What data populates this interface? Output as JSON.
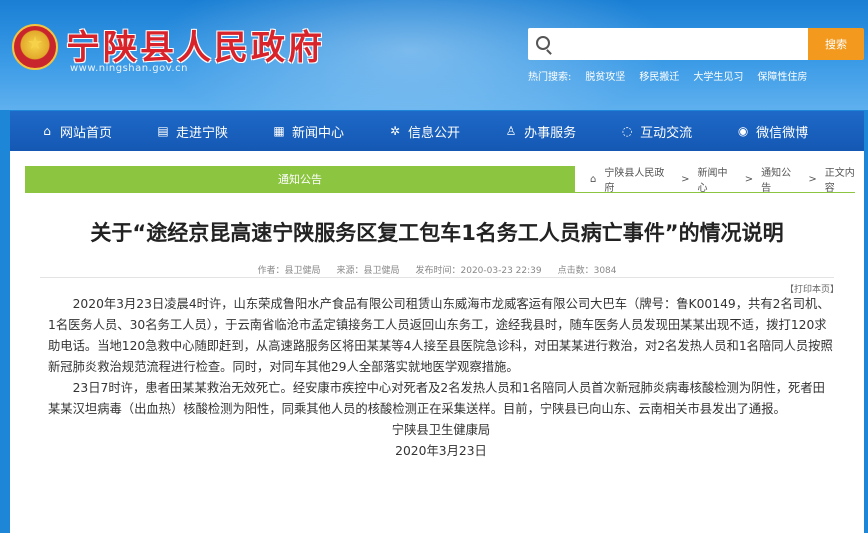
{
  "site": {
    "title": "宁陕县人民政府",
    "url": "www.ningshan.gov.cn"
  },
  "search": {
    "placeholder": "",
    "button_label": "搜索",
    "hot_label": "热门搜索:",
    "hot_items": [
      "脱贫攻坚",
      "移民搬迁",
      "大学生见习",
      "保障性住房"
    ]
  },
  "nav": {
    "items": [
      {
        "label": "网站首页",
        "icon": "home-icon"
      },
      {
        "label": "走进宁陕",
        "icon": "document-icon"
      },
      {
        "label": "新闻中心",
        "icon": "news-icon"
      },
      {
        "label": "信息公开",
        "icon": "gear-icon"
      },
      {
        "label": "办事服务",
        "icon": "user-icon"
      },
      {
        "label": "互动交流",
        "icon": "chat-icon"
      },
      {
        "label": "微信微博",
        "icon": "weibo-icon"
      }
    ]
  },
  "section": {
    "tab_label": "通知公告",
    "breadcrumb": [
      "宁陕县人民政府",
      ">",
      "新闻中心",
      ">",
      "通知公告",
      ">",
      "正文内容"
    ]
  },
  "article": {
    "title": "关于“途经京昆高速宁陕服务区复工包车1名务工人员病亡事件”的情况说明",
    "author": "作者：县卫健局",
    "source": "来源：县卫健局",
    "time": "发布时间：2020-03-23 22:39",
    "hits": "点击数：3084",
    "print_label": "【打印本页】",
    "paragraphs": [
      "2020年3月23日凌晨4时许，山东荣成鲁阳水产食品有限公司租赁山东威海市龙威客运有限公司大巴车（牌号：鲁K00149，共有2名司机、1名医务人员、30名务工人员），于云南省临沧市孟定镇接务工人员返回山东务工，途经我县时，随车医务人员发现田某某出现不适，拨打120求助电话。当地120急救中心随即赶到，从高速路服务区将田某某等4人接至县医院急诊科，对田某某进行救治，对2名发热人员和1名陪同人员按照新冠肺炎救治规范流程进行检查。同时，对同车其他29人全部落实就地医学观察措施。",
      "23日7时许，患者田某某救治无效死亡。经安康市疾控中心对死者及2名发热人员和1名陪同人员首次新冠肺炎病毒核酸检测为阴性，死者田某某汉坦病毒（出血热）核酸检测为阳性，同乘其他人员的核酸检测正在采集送样。目前，宁陕县已向山东、云南相关市县发出了通报。"
    ],
    "signature": "宁陕县卫生健康局",
    "date": "2020年3月23日"
  }
}
